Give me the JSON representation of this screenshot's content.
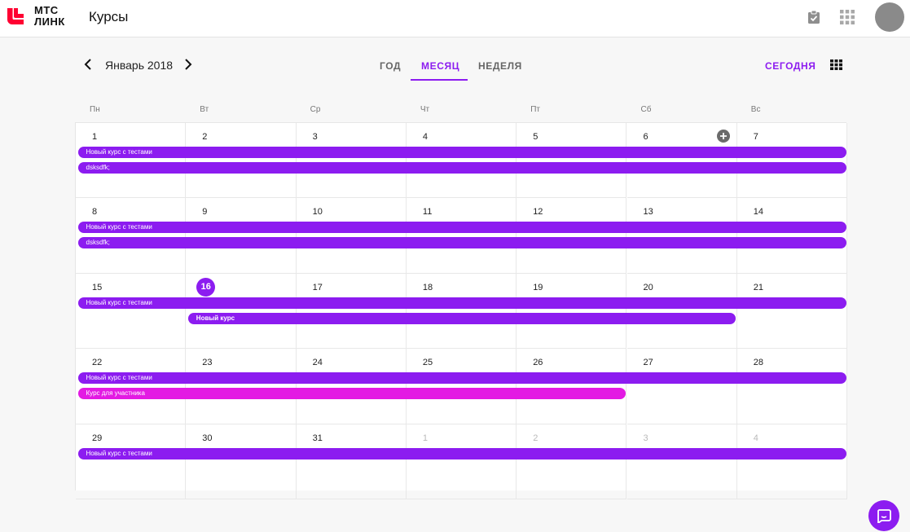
{
  "header": {
    "logo_line1": "МТС",
    "logo_line2": "ЛИНК",
    "title": "Курсы",
    "icons": [
      "logo-mark",
      "tasks-check-icon",
      "apps-grid-icon",
      "avatar"
    ]
  },
  "toolbar": {
    "month_label": "Январь 2018",
    "tabs": [
      {
        "label": "ГОД",
        "active": false
      },
      {
        "label": "МЕСЯЦ",
        "active": true
      },
      {
        "label": "НЕДЕЛЯ",
        "active": false
      }
    ],
    "today_label": "СЕГОДНЯ"
  },
  "colors": {
    "accent": "#8c1cf0",
    "pink": "#e31ae3",
    "logo_red": "#ff0032"
  },
  "calendar": {
    "weekdays": [
      "Пн",
      "Вт",
      "Ср",
      "Чт",
      "Пт",
      "Сб",
      "Вс"
    ],
    "today": "16",
    "weeks": [
      {
        "days": [
          {
            "n": "1",
            "muted": false
          },
          {
            "n": "2",
            "muted": false
          },
          {
            "n": "3",
            "muted": false
          },
          {
            "n": "4",
            "muted": false
          },
          {
            "n": "5",
            "muted": false
          },
          {
            "n": "6",
            "muted": false
          },
          {
            "n": "7",
            "muted": false
          }
        ],
        "events": [
          {
            "title": "Новый курс с тестами",
            "start_day": 0,
            "span_days": 7,
            "color": "purple",
            "bold": false
          },
          {
            "title": "dsksdfk;",
            "start_day": 0,
            "span_days": 7,
            "color": "purple",
            "bold": false
          }
        ]
      },
      {
        "days": [
          {
            "n": "8",
            "muted": false
          },
          {
            "n": "9",
            "muted": false
          },
          {
            "n": "10",
            "muted": false
          },
          {
            "n": "11",
            "muted": false
          },
          {
            "n": "12",
            "muted": false
          },
          {
            "n": "13",
            "muted": false
          },
          {
            "n": "14",
            "muted": false
          }
        ],
        "events": [
          {
            "title": "Новый курс с тестами",
            "start_day": 0,
            "span_days": 7,
            "color": "purple",
            "bold": false
          },
          {
            "title": "dsksdfk;",
            "start_day": 0,
            "span_days": 7,
            "color": "purple",
            "bold": false
          }
        ]
      },
      {
        "days": [
          {
            "n": "15",
            "muted": false
          },
          {
            "n": "16",
            "muted": false
          },
          {
            "n": "17",
            "muted": false
          },
          {
            "n": "18",
            "muted": false
          },
          {
            "n": "19",
            "muted": false
          },
          {
            "n": "20",
            "muted": false
          },
          {
            "n": "21",
            "muted": false
          }
        ],
        "events": [
          {
            "title": "Новый курс с тестами",
            "start_day": 0,
            "span_days": 7,
            "color": "purple",
            "bold": false
          },
          {
            "title": "Новый курс",
            "start_day": 1,
            "span_days": 5,
            "color": "purple",
            "bold": true
          }
        ]
      },
      {
        "days": [
          {
            "n": "22",
            "muted": false
          },
          {
            "n": "23",
            "muted": false
          },
          {
            "n": "24",
            "muted": false
          },
          {
            "n": "25",
            "muted": false
          },
          {
            "n": "26",
            "muted": false
          },
          {
            "n": "27",
            "muted": false
          },
          {
            "n": "28",
            "muted": false
          }
        ],
        "events": [
          {
            "title": "Новый курс с тестами",
            "start_day": 0,
            "span_days": 7,
            "color": "purple",
            "bold": false
          },
          {
            "title": "Курс для участника",
            "start_day": 0,
            "span_days": 5,
            "color": "pink",
            "bold": false
          }
        ]
      },
      {
        "days": [
          {
            "n": "29",
            "muted": false
          },
          {
            "n": "30",
            "muted": false
          },
          {
            "n": "31",
            "muted": false
          },
          {
            "n": "1",
            "muted": true
          },
          {
            "n": "2",
            "muted": true
          },
          {
            "n": "3",
            "muted": true
          },
          {
            "n": "4",
            "muted": true
          }
        ],
        "events": [
          {
            "title": "Новый курс с тестами",
            "start_day": 0,
            "span_days": 7,
            "color": "purple",
            "bold": false
          }
        ]
      }
    ]
  }
}
